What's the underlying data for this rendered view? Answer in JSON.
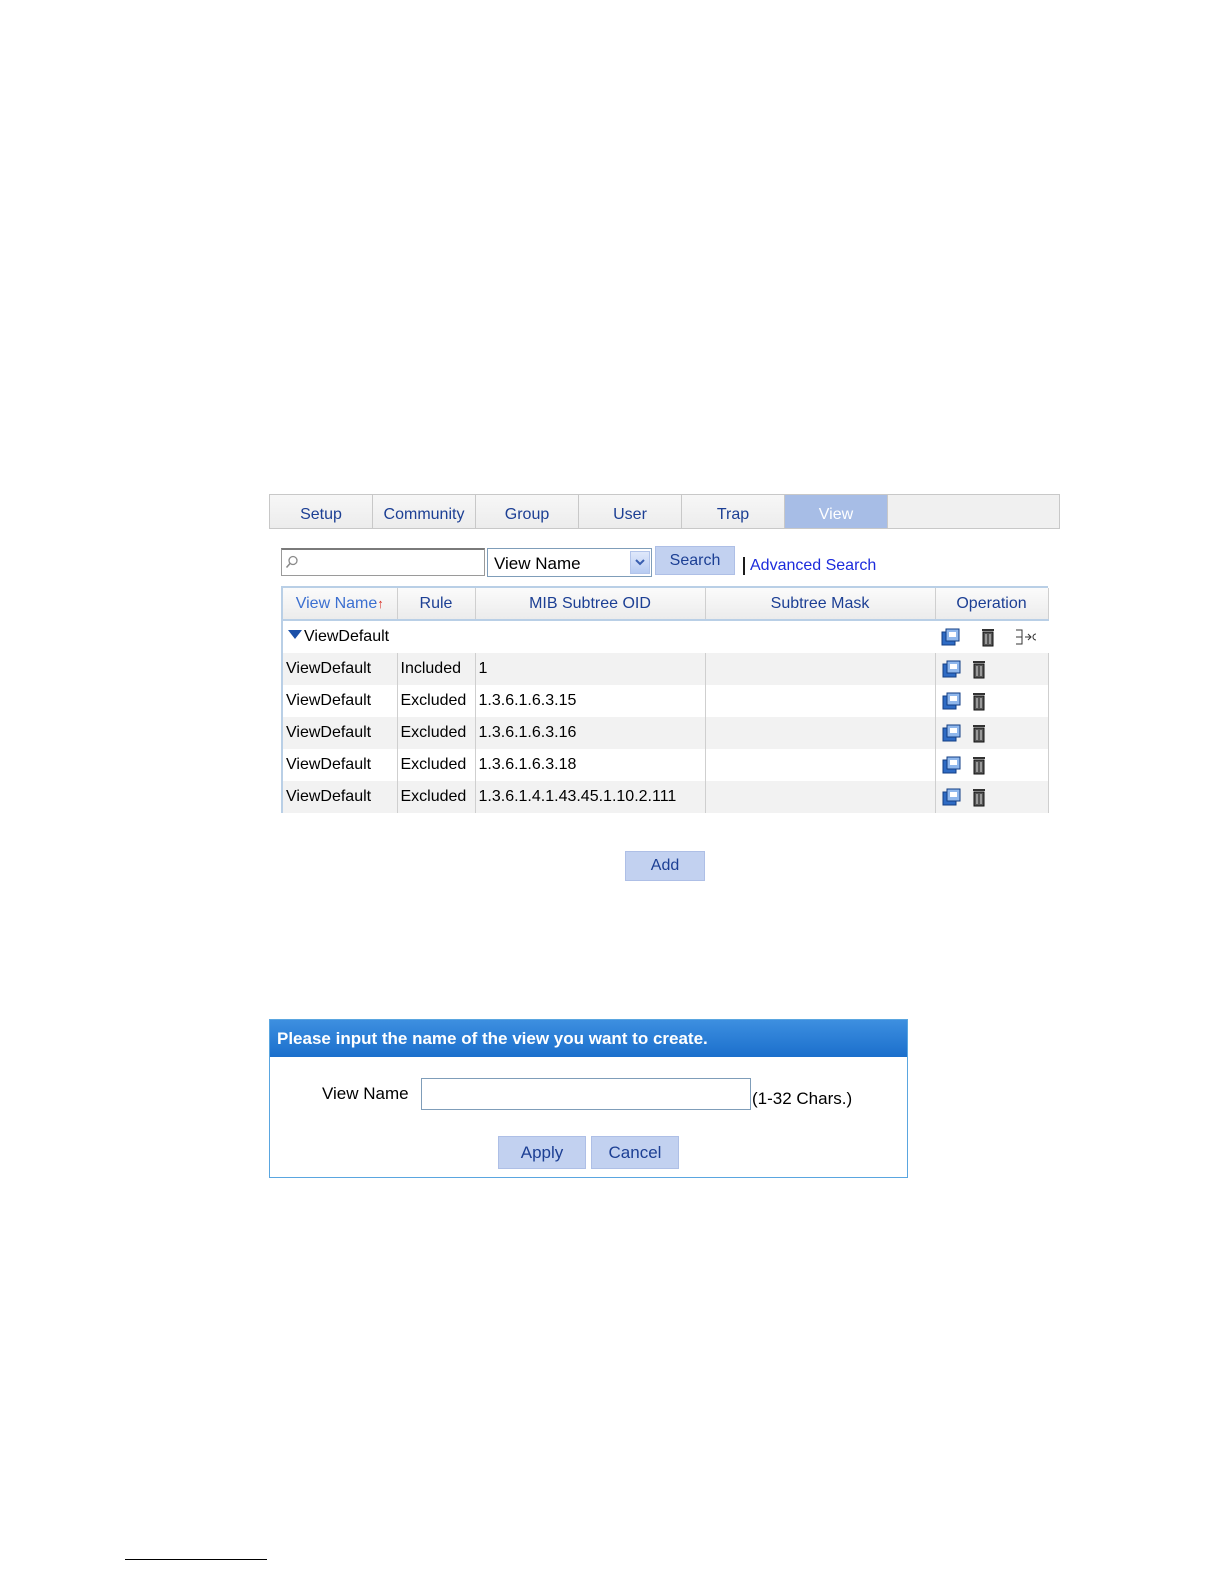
{
  "tabs": [
    "Setup",
    "Community",
    "Group",
    "User",
    "Trap",
    "View"
  ],
  "active_tab": "View",
  "search": {
    "value": "",
    "placeholder": "",
    "field": "View Name",
    "button": "Search",
    "advanced": "Advanced Search"
  },
  "table": {
    "headers": {
      "view_name": "View Name",
      "sort_arrow": "↑",
      "rule": "Rule",
      "oid": "MIB Subtree OID",
      "mask": "Subtree Mask",
      "operation": "Operation"
    },
    "group": "ViewDefault",
    "rows": [
      {
        "view": "ViewDefault",
        "rule": "Included",
        "oid": "1",
        "mask": ""
      },
      {
        "view": "ViewDefault",
        "rule": "Excluded",
        "oid": "1.3.6.1.6.3.15",
        "mask": ""
      },
      {
        "view": "ViewDefault",
        "rule": "Excluded",
        "oid": "1.3.6.1.6.3.16",
        "mask": ""
      },
      {
        "view": "ViewDefault",
        "rule": "Excluded",
        "oid": "1.3.6.1.6.3.18",
        "mask": ""
      },
      {
        "view": "ViewDefault",
        "rule": "Excluded",
        "oid": "1.3.6.1.4.1.43.45.1.10.2.111",
        "mask": ""
      }
    ]
  },
  "add_button": "Add",
  "dialog": {
    "title": "Please input the name of the view you want to create.",
    "label": "View Name",
    "value": "",
    "hint": "(1-32 Chars.)",
    "apply": "Apply",
    "cancel": "Cancel"
  },
  "colors": {
    "tab_active": "#a7bde6",
    "button": "#c2d1f0",
    "dialog_title": "#1b6fcc",
    "link": "#1c2bdc"
  }
}
